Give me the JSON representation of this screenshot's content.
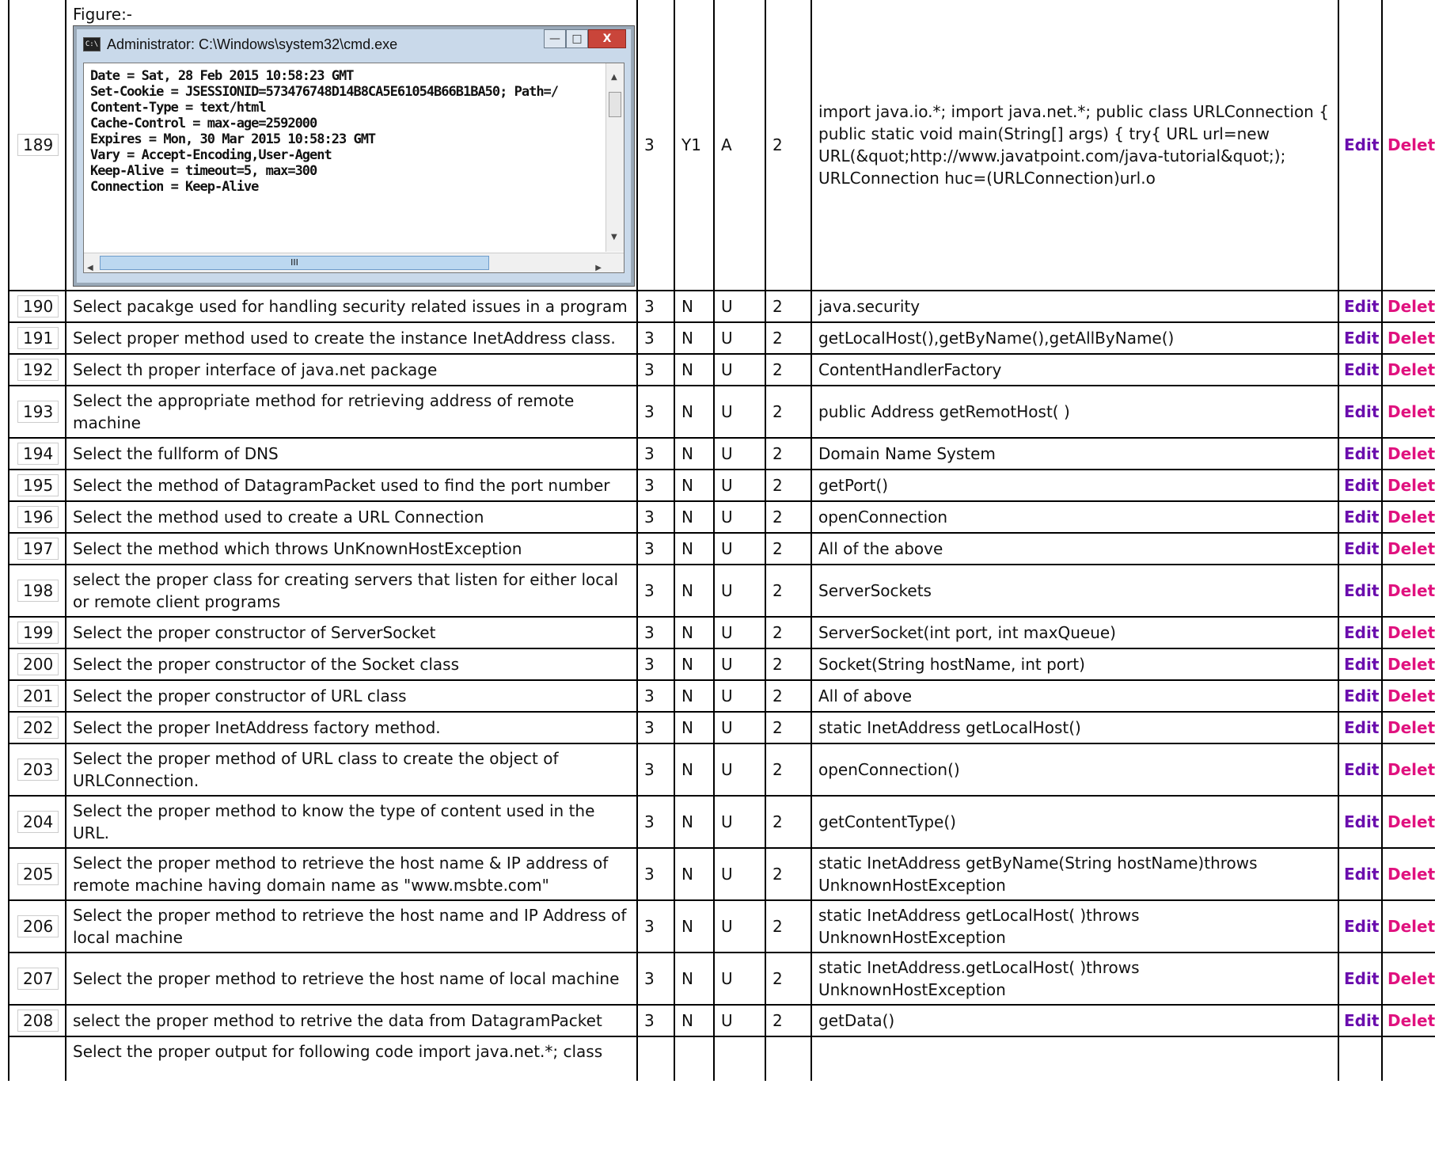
{
  "actions": {
    "edit": "Edit",
    "delete": "Delete"
  },
  "figure": {
    "label": "Figure:-",
    "window_title": "Administrator: C:\\Windows\\system32\\cmd.exe",
    "console_lines": [
      "Date = Sat, 28 Feb 2015 10:58:23 GMT",
      "Set-Cookie = JSESSIONID=573476748D14B8CA5E61054B66B1BA50; Path=/",
      "Content-Type = text/html",
      "Cache-Control = max-age=2592000",
      "Expires = Mon, 30 Mar 2015 10:58:23 GMT",
      "Vary = Accept-Encoding,User-Agent",
      "Keep-Alive = timeout=5, max=300",
      "Connection = Keep-Alive"
    ],
    "scroll_thumb_label": "III"
  },
  "rows": [
    {
      "id": "189",
      "question": "",
      "c1": "3",
      "c2": "Y1",
      "c3": "A",
      "c4": "2",
      "answer": "import java.io.*; import java.net.*; public class URLConnection { public static void main(String[] args) { try{ URL url=new URL(&quot;http://www.javatpoint.com/java-tutorial&quot;); URLConnection huc=(URLConnection)url.o"
    },
    {
      "id": "190",
      "question": "Select pacakge used for handling security related issues in a program",
      "c1": "3",
      "c2": "N",
      "c3": "U",
      "c4": "2",
      "answer": "java.security"
    },
    {
      "id": "191",
      "question": "Select proper method used to create the instance InetAddress class.",
      "c1": "3",
      "c2": "N",
      "c3": "U",
      "c4": "2",
      "answer": "getLocalHost(),getByName(),getAllByName()"
    },
    {
      "id": "192",
      "question": "Select th proper interface of java.net package",
      "c1": "3",
      "c2": "N",
      "c3": "U",
      "c4": "2",
      "answer": "ContentHandlerFactory"
    },
    {
      "id": "193",
      "question": "Select the appropriate method for retrieving address of remote machine",
      "c1": "3",
      "c2": "N",
      "c3": "U",
      "c4": "2",
      "answer": "public Address getRemotHost( )"
    },
    {
      "id": "194",
      "question": "Select the fullform of DNS",
      "c1": "3",
      "c2": "N",
      "c3": "U",
      "c4": "2",
      "answer": "Domain Name System"
    },
    {
      "id": "195",
      "question": "Select the method of DatagramPacket used to find the port number",
      "c1": "3",
      "c2": "N",
      "c3": "U",
      "c4": "2",
      "answer": "getPort()"
    },
    {
      "id": "196",
      "question": "Select the method used to create a URL Connection",
      "c1": "3",
      "c2": "N",
      "c3": "U",
      "c4": "2",
      "answer": "openConnection"
    },
    {
      "id": "197",
      "question": "Select the method which throws UnKnownHostException",
      "c1": "3",
      "c2": "N",
      "c3": "U",
      "c4": "2",
      "answer": "All of the above"
    },
    {
      "id": "198",
      "question": "select the proper class for creating servers that listen for either local or remote client programs",
      "c1": "3",
      "c2": "N",
      "c3": "U",
      "c4": "2",
      "answer": "ServerSockets"
    },
    {
      "id": "199",
      "question": "Select the proper constructor of ServerSocket",
      "c1": "3",
      "c2": "N",
      "c3": "U",
      "c4": "2",
      "answer": "ServerSocket(int port, int maxQueue)"
    },
    {
      "id": "200",
      "question": "Select the proper constructor of the Socket class",
      "c1": "3",
      "c2": "N",
      "c3": "U",
      "c4": "2",
      "answer": "Socket(String hostName, int port)"
    },
    {
      "id": "201",
      "question": "Select the proper constructor of URL class",
      "c1": "3",
      "c2": "N",
      "c3": "U",
      "c4": "2",
      "answer": "All of above"
    },
    {
      "id": "202",
      "question": "Select the proper InetAddress factory method.",
      "c1": "3",
      "c2": "N",
      "c3": "U",
      "c4": "2",
      "answer": "static InetAddress getLocalHost()"
    },
    {
      "id": "203",
      "question": "Select the proper method of URL class to create the object of URLConnection.",
      "c1": "3",
      "c2": "N",
      "c3": "U",
      "c4": "2",
      "answer": "openConnection()"
    },
    {
      "id": "204",
      "question": "Select the proper method to know the type of content used in the URL.",
      "c1": "3",
      "c2": "N",
      "c3": "U",
      "c4": "2",
      "answer": "getContentType()"
    },
    {
      "id": "205",
      "question": "Select the proper method to retrieve the host name & IP address of remote machine having domain name as \"www.msbte.com\"",
      "c1": "3",
      "c2": "N",
      "c3": "U",
      "c4": "2",
      "answer": "static InetAddress getByName(String hostName)throws UnknownHostException"
    },
    {
      "id": "206",
      "question": "Select the proper method to retrieve the host name and IP Address of local machine",
      "c1": "3",
      "c2": "N",
      "c3": "U",
      "c4": "2",
      "answer": "static InetAddress getLocalHost( )throws UnknownHostException"
    },
    {
      "id": "207",
      "question": "Select the proper method to retrieve the host name of local machine",
      "c1": "3",
      "c2": "N",
      "c3": "U",
      "c4": "2",
      "answer": "static InetAddress.getLocalHost( )throws UnknownHostException"
    },
    {
      "id": "208",
      "question": "select the proper method to retrive the data from DatagramPacket",
      "c1": "3",
      "c2": "N",
      "c3": "U",
      "c4": "2",
      "answer": "getData()"
    },
    {
      "id": "",
      "question": "Select the proper output for following code import java.net.*; class",
      "c1": "",
      "c2": "",
      "c3": "",
      "c4": "",
      "answer": ""
    }
  ]
}
